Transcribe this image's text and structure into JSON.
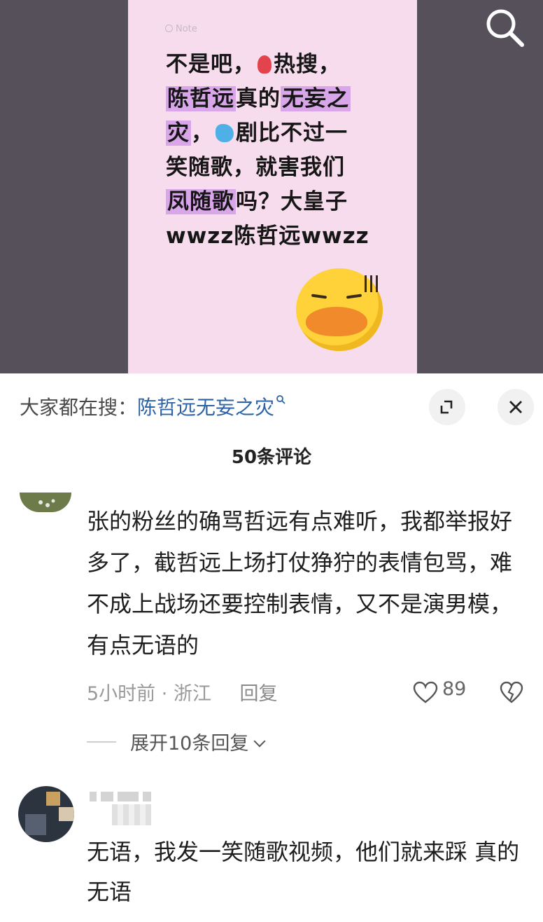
{
  "video": {
    "note_label": "Note",
    "note_lines": [
      {
        "parts": [
          {
            "t": "不是吧，",
            "hl": false
          },
          {
            "t": "",
            "emoji": "red-ribbon-icon"
          },
          {
            "t": "热搜，",
            "hl": false
          }
        ]
      },
      {
        "parts": [
          {
            "t": "陈哲远",
            "hl": true
          },
          {
            "t": "真的",
            "hl": false
          },
          {
            "t": "无妄之",
            "hl": true
          }
        ]
      },
      {
        "parts": [
          {
            "t": "灾",
            "hl": true
          },
          {
            "t": "，",
            "hl": false
          },
          {
            "t": "",
            "emoji": "sweat-drops-icon"
          },
          {
            "t": "剧比不过一",
            "hl": false
          }
        ]
      },
      {
        "parts": [
          {
            "t": "笑随歌，就害我们",
            "hl": false
          }
        ]
      },
      {
        "parts": [
          {
            "t": "凤随歌",
            "hl": true
          },
          {
            "t": "吗？大皇子",
            "hl": false
          }
        ]
      },
      {
        "parts": [
          {
            "t": "wwzz陈哲远wwzz",
            "hl": false
          }
        ]
      }
    ],
    "sticker_icon": "duck-sticker-icon"
  },
  "search": {
    "icon": "search-icon"
  },
  "hot_search": {
    "prefix": "大家都在搜：",
    "query": "陈哲远无妄之灾"
  },
  "panel": {
    "expand_icon": "expand-icon",
    "close_icon": "close-icon",
    "comment_count": "50条评论"
  },
  "comments": [
    {
      "text": "张的粉丝的确骂哲远有点难听，我都举报好多了，截哲远上场打仗狰狞的表情包骂，难不成上战场还要控制表情，又不是演男模，有点无语的",
      "time": "5小时前",
      "location": "浙江",
      "reply_label": "回复",
      "likes": "89",
      "expand_replies": "展开10条回复"
    },
    {
      "text": "无语，我发一笑随歌视频，他们就来踩 真的无语"
    }
  ],
  "colors": {
    "highlight": "#d9a6ea",
    "link": "#2d63a6",
    "note_bg": "#f6dcec"
  }
}
